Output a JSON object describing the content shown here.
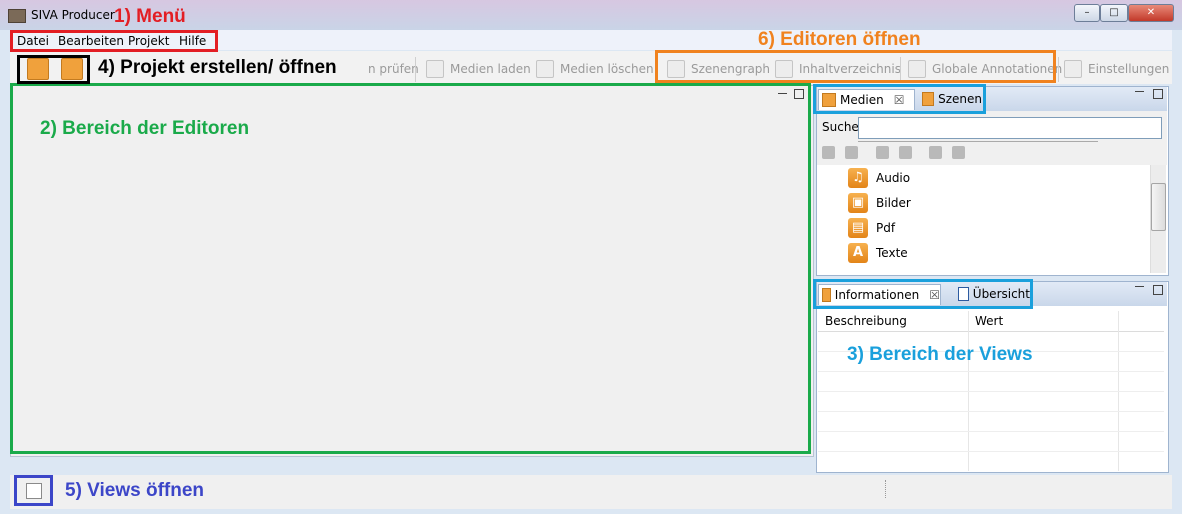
{
  "window": {
    "title": "SIVA Producer",
    "min_label": "–",
    "max_label": "□",
    "close_label": "✕"
  },
  "menu": {
    "items": [
      "Datei",
      "Bearbeiten",
      "Projekt",
      "Hilfe"
    ]
  },
  "toolbar": {
    "hidden_label": "n prüfen",
    "medien_laden": "Medien laden",
    "medien_loeschen": "Medien löschen",
    "szenengraph": "Szenengraph",
    "inhaltsverzeichnis": "Inhaltverzeichnis",
    "globale_annotationen": "Globale Annotationen",
    "einstellungen": "Einstellungen"
  },
  "media_view": {
    "tabs": [
      {
        "label": "Medien",
        "close": "☒"
      },
      {
        "label": "Szenen"
      }
    ],
    "search_label": "Suche",
    "search_value": "",
    "items": [
      {
        "label": "Audio",
        "icon": "audio-icon",
        "glyph": "♫"
      },
      {
        "label": "Bilder",
        "icon": "image-icon",
        "glyph": "▣"
      },
      {
        "label": "Pdf",
        "icon": "pdf-icon",
        "glyph": "▤"
      },
      {
        "label": "Texte",
        "icon": "text-icon",
        "glyph": "A"
      }
    ]
  },
  "info_view": {
    "tabs": [
      {
        "label": "Informationen",
        "close": "☒"
      },
      {
        "label": "Übersicht"
      }
    ],
    "columns": [
      "Beschreibung",
      "Wert"
    ]
  },
  "annotations": {
    "menu": "1) Menü",
    "editors": "2) Bereich der Editoren",
    "views": "3) Bereich der Views",
    "project": "4) Projekt erstellen/ öffnen",
    "views_open": "5) Views öffnen",
    "editors_open": "6) Editoren öffnen"
  },
  "colors": {
    "red": "#e31e24",
    "green": "#1aaa4a",
    "blue": "#1aa0dc",
    "black": "#000000",
    "indigo": "#3c46c8",
    "orange": "#f0821e"
  }
}
